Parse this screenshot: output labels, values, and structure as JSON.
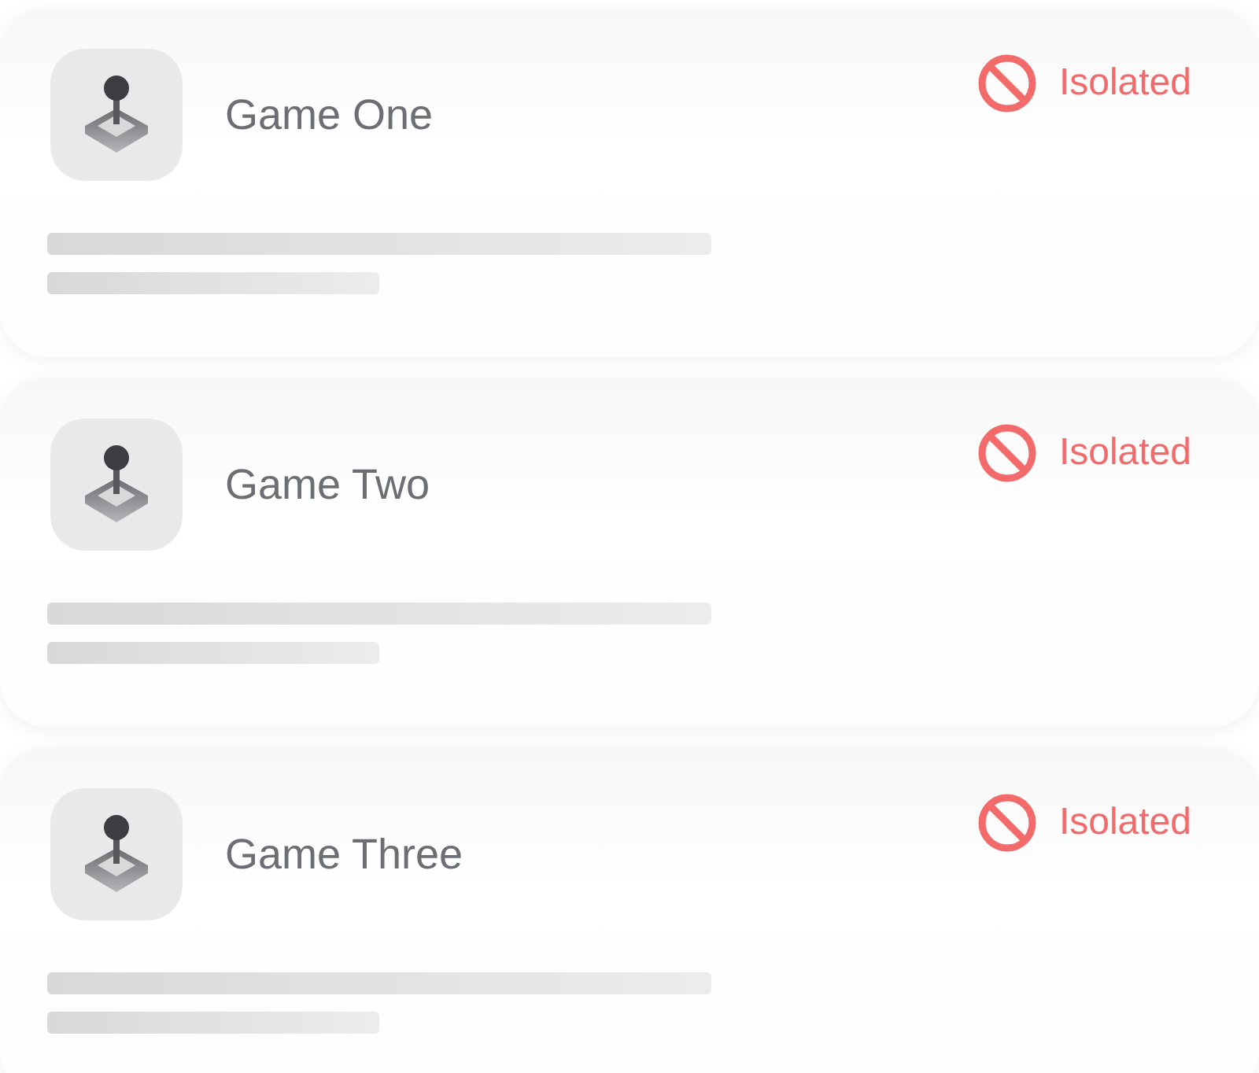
{
  "games": [
    {
      "title": "Game One",
      "status": {
        "kind": "isolated",
        "label": "Isolated"
      }
    },
    {
      "title": "Game Two",
      "status": {
        "kind": "isolated",
        "label": "Isolated"
      }
    },
    {
      "title": "Game Three",
      "status": {
        "kind": "isolated",
        "label": "Isolated"
      }
    }
  ]
}
